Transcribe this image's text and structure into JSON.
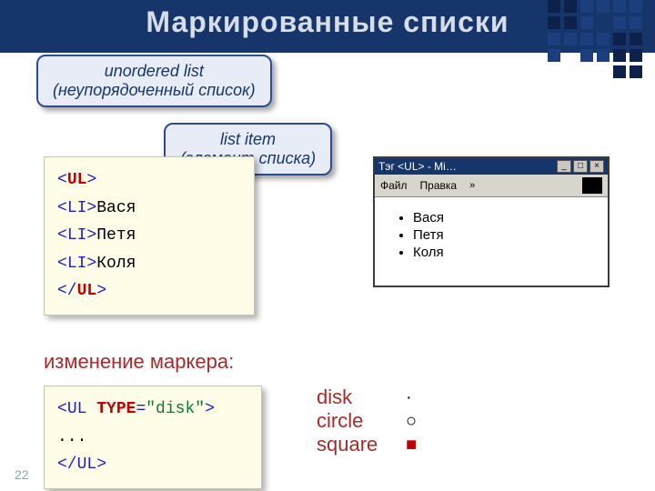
{
  "title": "Маркированные списки",
  "callout1_line1": "unordered list",
  "callout1_line2": "(неупорядоченный список)",
  "callout2_line1": "list item",
  "callout2_line2": "(элемент списка)",
  "code1": {
    "open_text": "UL",
    "li": "LI",
    "names": [
      "Вася",
      "Петя",
      "Коля"
    ],
    "close_text": "UL"
  },
  "marker_label": "изменение маркера:",
  "code2": {
    "ul": "UL",
    "attr": " TYPE",
    "eq": "=",
    "val": "\"disk\"",
    "dots": "...",
    "close": "UL"
  },
  "browser": {
    "title": "Тэг  <UL>  -  Mi…",
    "menu": [
      "Файл",
      "Правка"
    ],
    "chev": "»",
    "items": [
      "Вася",
      "Петя",
      "Коля"
    ]
  },
  "markers": [
    {
      "name": "disk",
      "symbol": "·"
    },
    {
      "name": "circle",
      "symbol": "○"
    },
    {
      "name": "square",
      "symbol": "■"
    }
  ],
  "page_number": "22"
}
